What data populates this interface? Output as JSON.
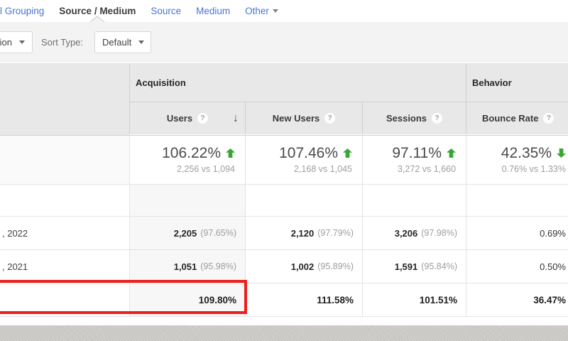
{
  "nav": {
    "items": [
      {
        "label": "l Grouping"
      },
      {
        "label": "Source / Medium"
      },
      {
        "label": "Source"
      },
      {
        "label": "Medium"
      },
      {
        "label": "Other"
      }
    ]
  },
  "toolbar": {
    "partial_dropdown_value": "ion",
    "sort_type_label": "Sort Type:",
    "sort_type_value": "Default"
  },
  "table": {
    "group_headers": {
      "acquisition": "Acquisition",
      "behavior": "Behavior"
    },
    "help_icon": "?",
    "sort_icon": "↓",
    "columns": {
      "users": "Users",
      "new_users": "New Users",
      "sessions": "Sessions",
      "bounce_rate": "Bounce Rate"
    },
    "summary": {
      "users": {
        "pct": "106.22%",
        "direction": "up",
        "sub": "2,256 vs 1,094"
      },
      "new_users": {
        "pct": "107.46%",
        "direction": "up",
        "sub": "2,168 vs 1,045"
      },
      "sessions": {
        "pct": "97.11%",
        "direction": "up",
        "sub": "3,272 vs 1,660"
      },
      "bounce_rate": {
        "pct": "42.35%",
        "direction": "down",
        "sub": "0.76% vs 1.33%"
      }
    },
    "rows": [
      {
        "label": ", 2022",
        "users": "2,205",
        "users_share": "(97.65%)",
        "new_users": "2,120",
        "new_users_share": "(97.79%)",
        "sessions": "3,206",
        "sessions_share": "(97.98%)",
        "bounce_rate": "0.69%"
      },
      {
        "label": ", 2021",
        "users": "1,051",
        "users_share": "(95.98%)",
        "new_users": "1,002",
        "new_users_share": "(95.89%)",
        "sessions": "1,591",
        "sessions_share": "(95.84%)",
        "bounce_rate": "0.50%"
      },
      {
        "label": "",
        "users": "109.80%",
        "new_users": "111.58%",
        "sessions": "101.51%",
        "bounce_rate": "36.47%",
        "highlighted": true
      }
    ]
  },
  "colors": {
    "link_blue": "#4a73d4",
    "arrow_green": "#38a535",
    "highlight_red": "#ee1f1a",
    "header_gray": "#e8e8e8"
  }
}
